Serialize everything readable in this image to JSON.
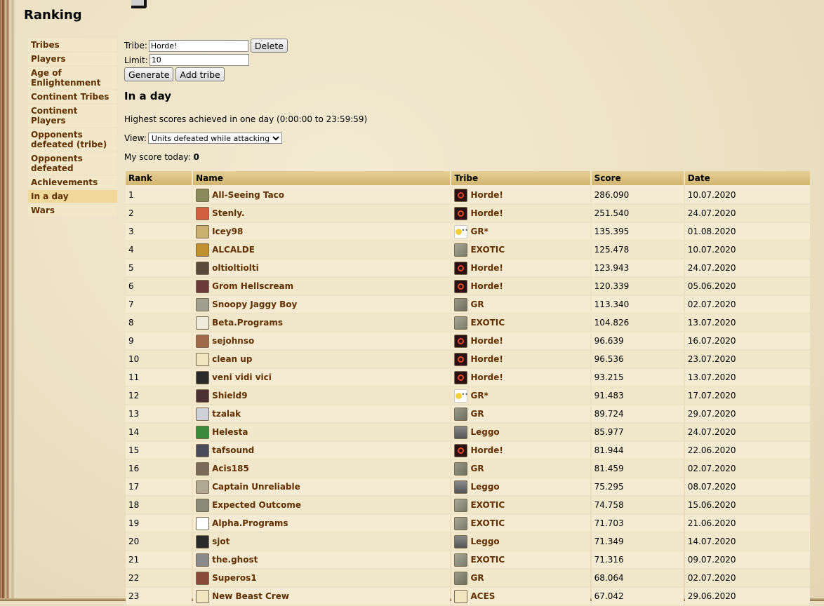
{
  "page": {
    "title": "Ranking"
  },
  "sidebar": {
    "items": [
      {
        "label": "Tribes",
        "active": false
      },
      {
        "label": "Players",
        "active": false
      },
      {
        "label": "Age of Enlightenment",
        "active": false
      },
      {
        "label": "Continent Tribes",
        "active": false
      },
      {
        "label": "Continent Players",
        "active": false
      },
      {
        "label": "Opponents defeated (tribe)",
        "active": false
      },
      {
        "label": "Opponents defeated",
        "active": false
      },
      {
        "label": "Achievements",
        "active": false
      },
      {
        "label": "In a day",
        "active": true
      },
      {
        "label": "Wars",
        "active": false
      }
    ]
  },
  "controls": {
    "tribe_label": "Tribe:",
    "tribe_value": "Horde!",
    "delete_label": "Delete",
    "limit_label": "Limit:",
    "limit_value": "10",
    "generate_label": "Generate",
    "add_tribe_label": "Add tribe"
  },
  "section": {
    "title": "In a day",
    "description": "Highest scores achieved in one day (0:00:00 to 23:59:59)",
    "view_label": "View:",
    "view_selected": "Units defeated while attacking",
    "myscore_label": "My score today:",
    "myscore_value": "0"
  },
  "table": {
    "headers": [
      "Rank",
      "Name",
      "Tribe",
      "Score",
      "Date"
    ],
    "rows": [
      {
        "rank": "1",
        "name": "All-Seeing Taco",
        "tribe": "Horde!",
        "score": "286.090",
        "date": "10.07.2020",
        "avatar": "#8a8a5a",
        "tribe_icon": "horde"
      },
      {
        "rank": "2",
        "name": "Stenly.",
        "tribe": "Horde!",
        "score": "251.540",
        "date": "24.07.2020",
        "avatar": "#d06040",
        "tribe_icon": "horde"
      },
      {
        "rank": "3",
        "name": "Icey98",
        "tribe": "GR*",
        "score": "135.395",
        "date": "01.08.2020",
        "avatar": "#c8b070",
        "tribe_icon": "gr-star"
      },
      {
        "rank": "4",
        "name": "ALCALDE",
        "tribe": "EXOTIC",
        "score": "125.478",
        "date": "10.07.2020",
        "avatar": "#c09030",
        "tribe_icon": "exotic"
      },
      {
        "rank": "5",
        "name": "oltioltiolti",
        "tribe": "Horde!",
        "score": "123.943",
        "date": "24.07.2020",
        "avatar": "#5a4a3a",
        "tribe_icon": "horde"
      },
      {
        "rank": "6",
        "name": "Grom Hellscream",
        "tribe": "Horde!",
        "score": "120.339",
        "date": "05.06.2020",
        "avatar": "#6a3a3a",
        "tribe_icon": "horde"
      },
      {
        "rank": "7",
        "name": "Snoopy Jaggy Boy",
        "tribe": "GR",
        "score": "113.340",
        "date": "02.07.2020",
        "avatar": "#a0a090",
        "tribe_icon": "gr"
      },
      {
        "rank": "8",
        "name": "Beta.Programs",
        "tribe": "EXOTIC",
        "score": "104.826",
        "date": "13.07.2020",
        "avatar": "#f0ecdc",
        "tribe_icon": "exotic"
      },
      {
        "rank": "9",
        "name": "sejohnso",
        "tribe": "Horde!",
        "score": "96.639",
        "date": "16.07.2020",
        "avatar": "#a06a4a",
        "tribe_icon": "horde"
      },
      {
        "rank": "10",
        "name": "clean up",
        "tribe": "Horde!",
        "score": "96.536",
        "date": "23.07.2020",
        "avatar": "#f2e6c0",
        "tribe_icon": "horde"
      },
      {
        "rank": "11",
        "name": "veni vidi vici",
        "tribe": "Horde!",
        "score": "93.215",
        "date": "13.07.2020",
        "avatar": "#2a2a2a",
        "tribe_icon": "horde"
      },
      {
        "rank": "12",
        "name": "Shield9",
        "tribe": "GR*",
        "score": "91.483",
        "date": "17.07.2020",
        "avatar": "#4a3030",
        "tribe_icon": "gr-star"
      },
      {
        "rank": "13",
        "name": "tzalak",
        "tribe": "GR",
        "score": "89.724",
        "date": "29.07.2020",
        "avatar": "#d0d0d8",
        "tribe_icon": "gr"
      },
      {
        "rank": "14",
        "name": "Helesta",
        "tribe": "Leggo",
        "score": "85.977",
        "date": "24.07.2020",
        "avatar": "#3a8a3a",
        "tribe_icon": "leggo"
      },
      {
        "rank": "15",
        "name": "tafsound",
        "tribe": "Horde!",
        "score": "81.944",
        "date": "22.06.2020",
        "avatar": "#4a4a5a",
        "tribe_icon": "horde"
      },
      {
        "rank": "16",
        "name": "Acis185",
        "tribe": "GR",
        "score": "81.459",
        "date": "02.07.2020",
        "avatar": "#7a6a5a",
        "tribe_icon": "gr"
      },
      {
        "rank": "17",
        "name": "Captain Unreliable",
        "tribe": "Leggo",
        "score": "75.295",
        "date": "08.07.2020",
        "avatar": "#b0a890",
        "tribe_icon": "leggo"
      },
      {
        "rank": "18",
        "name": "Expected Outcome",
        "tribe": "EXOTIC",
        "score": "74.758",
        "date": "15.06.2020",
        "avatar": "#8a8a7a",
        "tribe_icon": "exotic"
      },
      {
        "rank": "19",
        "name": "Alpha.Programs",
        "tribe": "EXOTIC",
        "score": "71.703",
        "date": "21.06.2020",
        "avatar": "#ffffff",
        "tribe_icon": "exotic"
      },
      {
        "rank": "20",
        "name": "sjot",
        "tribe": "Leggo",
        "score": "71.349",
        "date": "14.07.2020",
        "avatar": "#2a2a2a",
        "tribe_icon": "leggo"
      },
      {
        "rank": "21",
        "name": "the.ghost",
        "tribe": "EXOTIC",
        "score": "71.316",
        "date": "09.07.2020",
        "avatar": "#8a8a8a",
        "tribe_icon": "exotic"
      },
      {
        "rank": "22",
        "name": "Superos1",
        "tribe": "GR",
        "score": "68.064",
        "date": "02.07.2020",
        "avatar": "#8a4a3a",
        "tribe_icon": "gr"
      },
      {
        "rank": "23",
        "name": "New Beast Crew",
        "tribe": "ACES",
        "score": "67.042",
        "date": "29.06.2020",
        "avatar": "#f2e6c0",
        "tribe_icon": "aces"
      }
    ]
  },
  "colors": {
    "link": "#603000",
    "header_bg": "#d6bb78",
    "row_bg": "#f4ebd2",
    "active_nav": "#f0d99b"
  }
}
